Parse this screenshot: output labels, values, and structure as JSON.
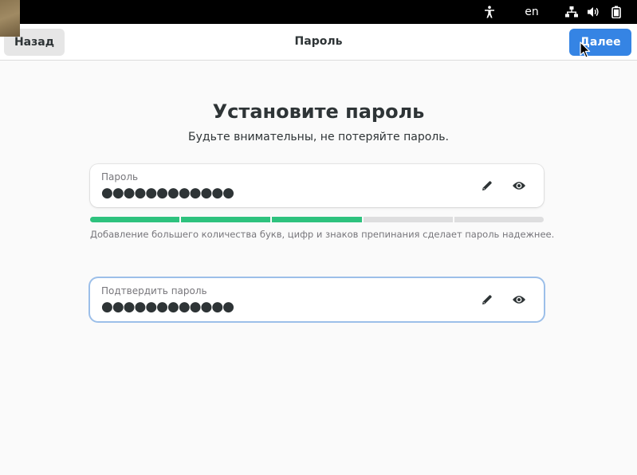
{
  "system_bar": {
    "language": "en",
    "icons": [
      "accessibility-icon",
      "network-icon",
      "volume-icon",
      "battery-icon"
    ]
  },
  "header": {
    "back_label": "Назад",
    "title": "Пароль",
    "next_label": "Далее"
  },
  "main": {
    "heading": "Установите пароль",
    "subheading": "Будьте внимательны, не потеряйте пароль.",
    "password_field": {
      "label": "Пароль",
      "value": "●●●●●●●●●●●●"
    },
    "strength": {
      "level": 3,
      "segments": 5,
      "color": "#2ec27e",
      "hint": "Добавление большего количества букв, цифр и знаков препинания сделает пароль надежнее."
    },
    "confirm_field": {
      "label": "Подтвердить пароль",
      "value": "●●●●●●●●●●●●"
    }
  },
  "colors": {
    "accent": "#3584e4",
    "focus_ring": "#9cbfe9",
    "background": "#fafafa"
  }
}
